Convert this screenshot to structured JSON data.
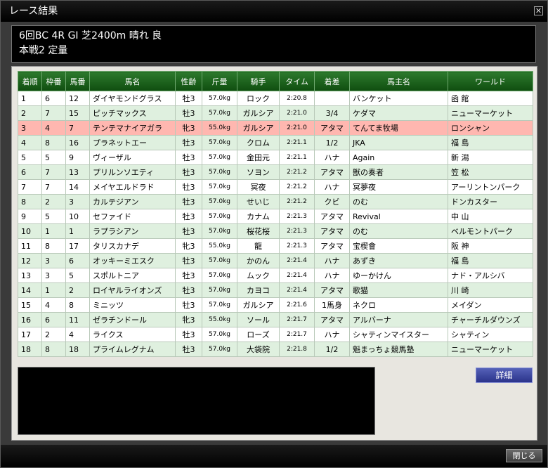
{
  "window": {
    "title": "レース結果",
    "close_glyph": "✕"
  },
  "race_info": {
    "line1": "6回BC 4R GⅠ 芝2400m 晴れ 良",
    "line2": "本戦2 定量"
  },
  "table": {
    "headers": [
      "着順",
      "枠番",
      "馬番",
      "馬名",
      "性齢",
      "斤量",
      "騎手",
      "タイム",
      "着差",
      "馬主名",
      "ワールド"
    ],
    "rows": [
      [
        "1",
        "6",
        "12",
        "ダイヤモンドグラス",
        "牡3",
        "57.0kg",
        "ロック",
        "2:20.8",
        "",
        "バンケット",
        "函 館"
      ],
      [
        "2",
        "7",
        "15",
        "ピッチマックス",
        "牡3",
        "57.0kg",
        "ガルシア",
        "2:21.0",
        "3/4",
        "ケダマ",
        "ニューマーケット"
      ],
      [
        "3",
        "4",
        "7",
        "テンテマナイアガラ",
        "牝3",
        "55.0kg",
        "ガルシア",
        "2:21.0",
        "アタマ",
        "てんてま牧場",
        "ロンシャン"
      ],
      [
        "4",
        "8",
        "16",
        "プラネットエー",
        "牡3",
        "57.0kg",
        "クロム",
        "2:21.1",
        "1/2",
        "JKA",
        "福 島"
      ],
      [
        "5",
        "5",
        "9",
        "ヴィーザル",
        "牡3",
        "57.0kg",
        "金田元",
        "2:21.1",
        "ハナ",
        "Again",
        "新 潟"
      ],
      [
        "6",
        "7",
        "13",
        "プリルンソエティ",
        "牡3",
        "57.0kg",
        "ソヨン",
        "2:21.2",
        "アタマ",
        "獣の奏者",
        "笠 松"
      ],
      [
        "7",
        "7",
        "14",
        "メイヤエルドラド",
        "牡3",
        "57.0kg",
        "冥夜",
        "2:21.2",
        "ハナ",
        "冥夢夜",
        "アーリントンパーク"
      ],
      [
        "8",
        "2",
        "3",
        "カルテジアン",
        "牡3",
        "57.0kg",
        "せいじ",
        "2:21.2",
        "クビ",
        "のむ",
        "ドンカスター"
      ],
      [
        "9",
        "5",
        "10",
        "セファイド",
        "牡3",
        "57.0kg",
        "カナム",
        "2:21.3",
        "アタマ",
        "Revival",
        "中 山"
      ],
      [
        "10",
        "1",
        "1",
        "ラプラシアン",
        "牡3",
        "57.0kg",
        "桜花桜",
        "2:21.3",
        "アタマ",
        "のむ",
        "ベルモントパーク"
      ],
      [
        "11",
        "8",
        "17",
        "タリスカナデ",
        "牝3",
        "55.0kg",
        "龍",
        "2:21.3",
        "アタマ",
        "宝楔會",
        "阪 神"
      ],
      [
        "12",
        "3",
        "6",
        "オッキーミエスク",
        "牡3",
        "57.0kg",
        "かのん",
        "2:21.4",
        "ハナ",
        "あずき",
        "福 島"
      ],
      [
        "13",
        "3",
        "5",
        "スポルトニア",
        "牡3",
        "57.0kg",
        "ムック",
        "2:21.4",
        "ハナ",
        "ゆーかけん",
        "ナド・アルシバ"
      ],
      [
        "14",
        "1",
        "2",
        "ロイヤルライオンズ",
        "牡3",
        "57.0kg",
        "カヨコ",
        "2:21.4",
        "アタマ",
        "歌猫",
        "川 崎"
      ],
      [
        "15",
        "4",
        "8",
        "ミニッツ",
        "牡3",
        "57.0kg",
        "ガルシア",
        "2:21.6",
        "1馬身",
        "ネクロ",
        "メイダン"
      ],
      [
        "16",
        "6",
        "11",
        "ゼラチンドール",
        "牝3",
        "55.0kg",
        "ソール",
        "2:21.7",
        "アタマ",
        "アルバーナ",
        "チャーチルダウンズ"
      ],
      [
        "17",
        "2",
        "4",
        "ライクス",
        "牡3",
        "57.0kg",
        "ローズ",
        "2:21.7",
        "ハナ",
        "シャティンマイスター",
        "シャティン"
      ],
      [
        "18",
        "8",
        "18",
        "プライムレグナム",
        "牡3",
        "57.0kg",
        "大袋院",
        "2:21.8",
        "1/2",
        "魁まっちょ競馬塾",
        "ニューマーケット"
      ]
    ],
    "highlight_row": 2
  },
  "buttons": {
    "detail": "詳細",
    "close": "閉じる"
  },
  "colors": {
    "header_green": "#1f661f",
    "row_alt": "#dff0df",
    "row_highlight": "#ffb7b0",
    "button_blue": "#3b46a0"
  }
}
